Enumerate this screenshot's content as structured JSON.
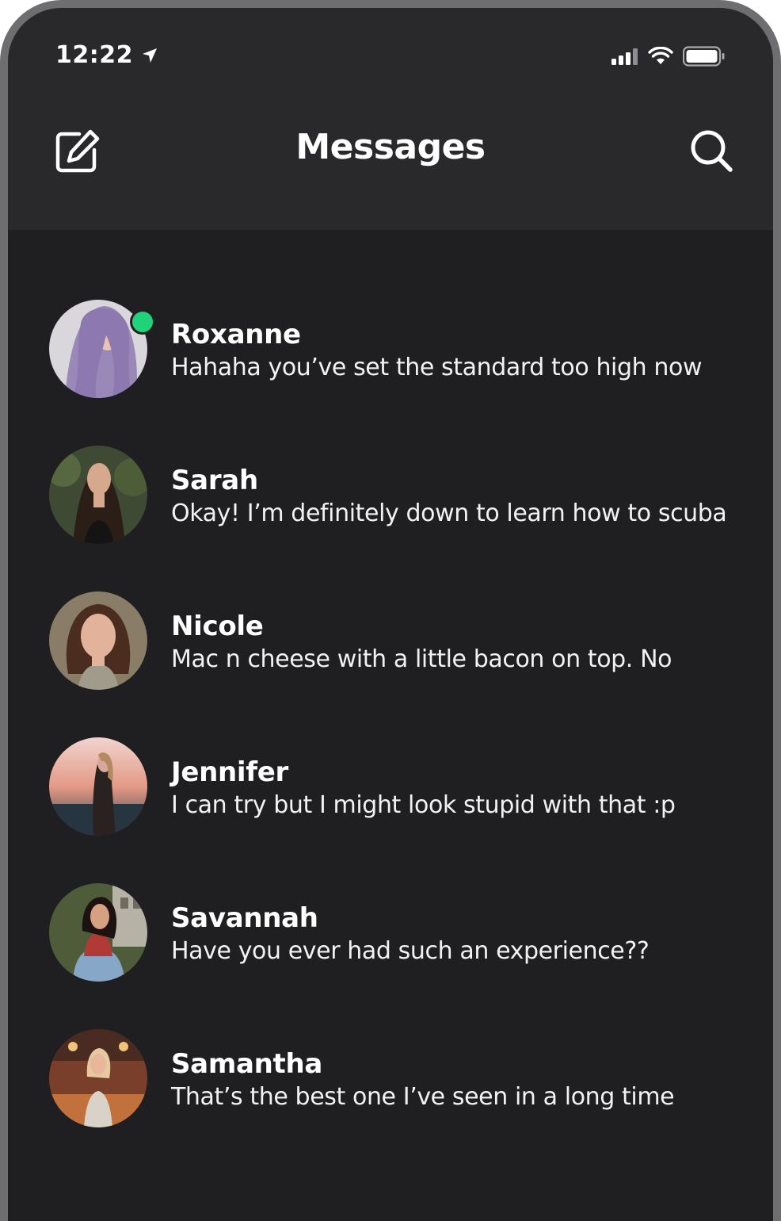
{
  "status_bar": {
    "time": "12:22",
    "icons": [
      "location-arrow-icon",
      "signal-icon",
      "wifi-icon",
      "battery-icon"
    ]
  },
  "nav": {
    "title": "Messages",
    "left_icon": "compose-icon",
    "right_icon": "search-icon"
  },
  "colors": {
    "background": "#1f1e20",
    "header": "#29282b",
    "online": "#1fd37a",
    "text": "#ffffff"
  },
  "conversations": [
    {
      "name": "Roxanne",
      "message": "Hahaha you’ve set the standard too high now",
      "online": true
    },
    {
      "name": "Sarah",
      "message": "Okay! I’m definitely down to learn how to scuba",
      "online": false
    },
    {
      "name": "Nicole",
      "message": "Mac n cheese with a little bacon on top. No",
      "online": false
    },
    {
      "name": "Jennifer",
      "message": "I can try but I might look stupid with that :p",
      "online": false
    },
    {
      "name": "Savannah",
      "message": "Have you ever had such an experience??",
      "online": false
    },
    {
      "name": "Samantha",
      "message": "That’s the best one I’ve seen in a long time",
      "online": false
    }
  ]
}
